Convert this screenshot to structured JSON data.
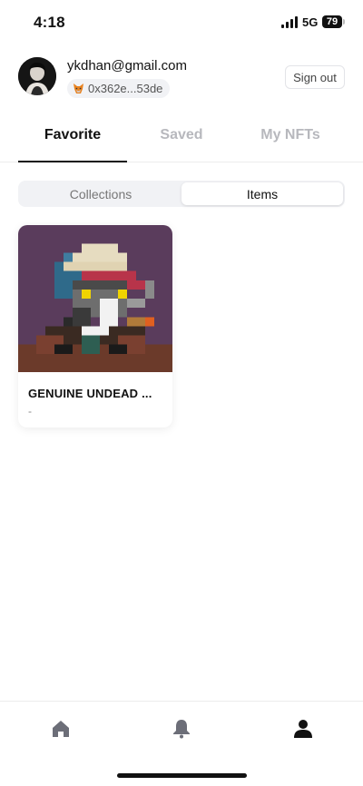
{
  "status_bar": {
    "time": "4:18",
    "network": "5G",
    "battery": "79"
  },
  "profile": {
    "email": "ykdhan@gmail.com",
    "wallet_address": "0x362e...53de",
    "wallet_icon": "metamask-fox-icon",
    "sign_out_label": "Sign out"
  },
  "tabs": [
    {
      "label": "Favorite",
      "active": true
    },
    {
      "label": "Saved",
      "active": false
    },
    {
      "label": "My NFTs",
      "active": false
    }
  ],
  "segment": {
    "options": [
      "Collections",
      "Items"
    ],
    "selected": "Items"
  },
  "items": [
    {
      "title": "GENUINE UNDEAD ...",
      "subtitle": "-",
      "image": "pixel-art-undead-nft"
    }
  ],
  "bottom_nav": [
    {
      "icon": "home-icon",
      "active": false
    },
    {
      "icon": "bell-icon",
      "active": false
    },
    {
      "icon": "profile-icon",
      "active": true
    }
  ],
  "colors": {
    "active_text": "#111111",
    "inactive_text": "#b7b8bd",
    "nav_inactive": "#6c6e78",
    "nav_active": "#111111"
  }
}
